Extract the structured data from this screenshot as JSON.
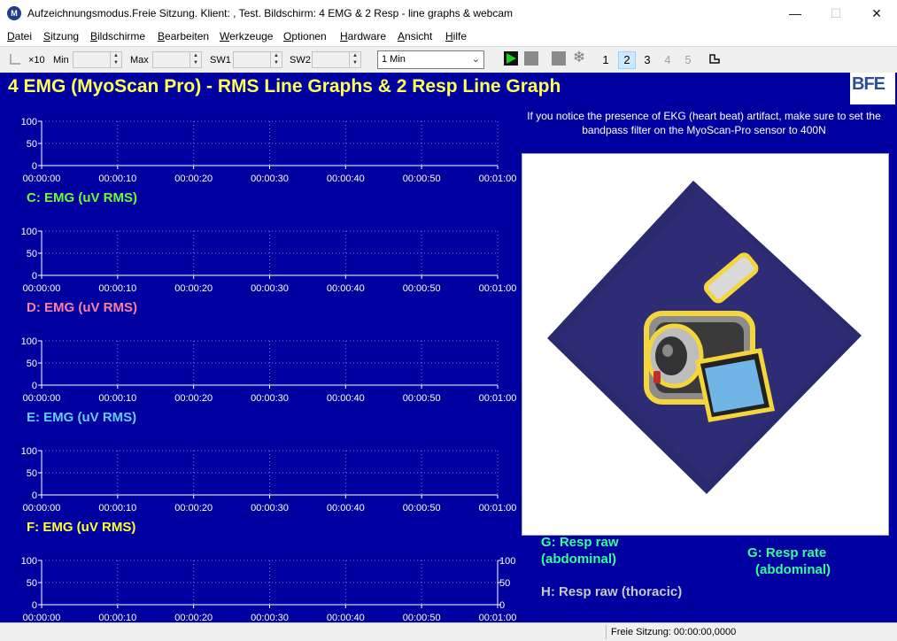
{
  "window": {
    "title": "Aufzeichnungsmodus.Freie Sitzung. Klient: , Test. Bildschirm: 4 EMG & 2 Resp - line graphs & webcam",
    "minimize": "—",
    "maximize": "☐",
    "close": "✕"
  },
  "menu": [
    "Datei",
    "Sitzung",
    "Bildschirme",
    "Bearbeiten",
    "Werkzeuge",
    "Optionen",
    "Hardware",
    "Ansicht",
    "Hilfe"
  ],
  "toolbar": {
    "zoom_label": "×10",
    "min_label": "Min",
    "max_label": "Max",
    "sw1_label": "SW1",
    "sw2_label": "SW2",
    "duration_value": "1 Min",
    "screens": [
      "1",
      "2",
      "3",
      "4",
      "5"
    ],
    "active_screen": "2"
  },
  "screen": {
    "title": "4 EMG (MyoScan Pro) - RMS Line Graphs & 2 Resp Line Graph",
    "logo_text": "BFE",
    "note": "If you notice the presence of EKG (heart beat) artifact, make sure to set the bandpass filter on the MyoScan-Pro sensor to 400N"
  },
  "graphs": [
    {
      "label": "C: EMG (uV RMS)",
      "label_color": "#66ff33",
      "y_ticks": [
        "100",
        "50",
        "0"
      ],
      "x_ticks": [
        "00:00:00",
        "00:00:10",
        "00:00:20",
        "00:00:30",
        "00:00:40",
        "00:00:50",
        "00:01:00"
      ]
    },
    {
      "label": "D: EMG (uV RMS)",
      "label_color": "#ff7f9f",
      "y_ticks": [
        "100",
        "50",
        "0"
      ],
      "x_ticks": [
        "00:00:00",
        "00:00:10",
        "00:00:20",
        "00:00:30",
        "00:00:40",
        "00:00:50",
        "00:01:00"
      ]
    },
    {
      "label": "E: EMG (uV RMS)",
      "label_color": "#66ccff",
      "y_ticks": [
        "100",
        "50",
        "0"
      ],
      "x_ticks": [
        "00:00:00",
        "00:00:10",
        "00:00:20",
        "00:00:30",
        "00:00:40",
        "00:00:50",
        "00:01:00"
      ]
    },
    {
      "label": "F: EMG (uV RMS)",
      "label_color": "#ffff33",
      "y_ticks": [
        "100",
        "50",
        "0"
      ],
      "x_ticks": [
        "00:00:00",
        "00:00:10",
        "00:00:20",
        "00:00:30",
        "00:00:40",
        "00:00:50",
        "00:01:00"
      ]
    },
    {
      "label": "",
      "label_color": "#ffffff",
      "y_ticks": [
        "100",
        "50",
        "0"
      ],
      "x_ticks": [
        "00:00:00",
        "00:00:10",
        "00:00:20",
        "00:00:30",
        "00:00:40",
        "00:00:50",
        "00:01:00"
      ],
      "right_axis": true
    }
  ],
  "resp": {
    "g_raw_line1": "G: Resp raw",
    "g_raw_line2": "(abdominal)",
    "g_rate_line1": "G: Resp rate",
    "g_rate_line2": "(abdominal)",
    "h_raw": "H: Resp raw (thoracic)",
    "g_color": "#33ff99",
    "h_color": "#c8c8c8"
  },
  "status": {
    "text": "Freie Sitzung: 00:00:00,0000"
  }
}
